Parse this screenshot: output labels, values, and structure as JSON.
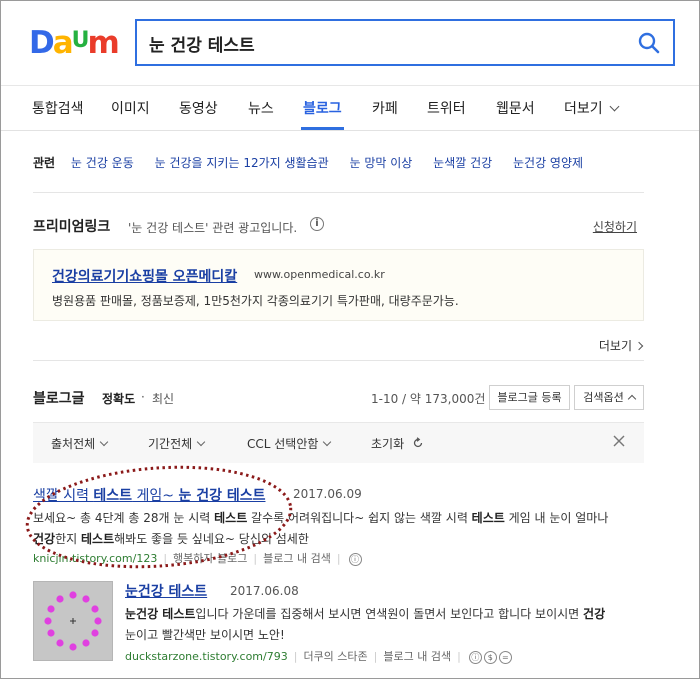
{
  "logo": {
    "letters": [
      "D",
      "a",
      "U",
      "m"
    ],
    "colors": [
      "#3369e8",
      "#ffb400",
      "#25b140",
      "#ea3c2a"
    ]
  },
  "search": {
    "query": "눈 건강 테스트",
    "button_icon": "magnifier-icon"
  },
  "tabs": [
    {
      "label": "통합검색",
      "active": false
    },
    {
      "label": "이미지",
      "active": false
    },
    {
      "label": "동영상",
      "active": false
    },
    {
      "label": "뉴스",
      "active": false
    },
    {
      "label": "블로그",
      "active": true
    },
    {
      "label": "카페",
      "active": false
    },
    {
      "label": "트위터",
      "active": false
    },
    {
      "label": "웹문서",
      "active": false
    },
    {
      "label": "더보기",
      "active": false
    }
  ],
  "related": {
    "label": "관련",
    "items": [
      "눈 건강 운동",
      "눈 건강을 지키는 12가지 생활습관",
      "눈 망막 이상",
      "눈색깔 건강",
      "눈건강 영양제"
    ]
  },
  "premium": {
    "title": "프리미엄링크",
    "desc": "'눈 건강 테스트' 관련 광고입니다.",
    "info_icon": "i",
    "apply": "신청하기",
    "ad": {
      "title": "건강의료기기쇼핑몰 오픈메디칼",
      "url": "www.openmedical.co.kr",
      "desc": "병원용품 판매몰, 정품보증제, 1만5천가지 각종의료기기 특가판매, 대량주문가능."
    },
    "more": "더보기"
  },
  "blog": {
    "title": "블로그글",
    "sort_accuracy": "정확도",
    "sort_dot": "·",
    "sort_latest": "최신",
    "count": "1-10 / 약 173,000건",
    "register_btn": "블로그글 등록",
    "options_btn": "검색옵션"
  },
  "filters": {
    "source": "출처전체",
    "period": "기간전체",
    "ccl": "CCL 선택안함",
    "reset": "초기화"
  },
  "results": [
    {
      "title_parts": [
        "색깔 시력 ",
        "테스트",
        " 게임~ ",
        "눈 건강 테스트"
      ],
      "date": "2017.06.09",
      "desc_line1": [
        "보세요~ 총 4단계 총 28개 눈 시력 ",
        "테스트",
        " 갈수록 어려워집니다~ 쉽지 않는 색깔 시력 ",
        "테스트",
        " 게임 내 눈이 얼마나"
      ],
      "desc_line2": [
        "건강",
        "한지 ",
        "테스트",
        "해봐도 좋을 듯 싶네요~ 당신의 섬세한"
      ],
      "source": "knicjin.tistory.com/123",
      "blog_name": "행복하자 블로그",
      "in_blog_search": "블로그 내 검색"
    },
    {
      "title_parts": [
        "눈건강 테스트"
      ],
      "date": "2017.06.08",
      "desc_line1": [
        "눈건강 테스트",
        "입니다 가운데를 집중해서 보시면 연색원이 돌면서 보인다고 합니다 보이시면 ",
        "건강"
      ],
      "desc_line2": [
        "눈이고 빨간색만 보이시면 노안!"
      ],
      "source": "duckstarzone.tistory.com/793",
      "blog_name": "더쿠의 스타존",
      "in_blog_search": "블로그 내 검색"
    }
  ],
  "colors": {
    "accent": "#2f6fe0",
    "link": "#1a3fa3",
    "source_green": "#2e7d32",
    "annotation": "#8b1a1a",
    "thumb_dots": "#e040e0"
  }
}
